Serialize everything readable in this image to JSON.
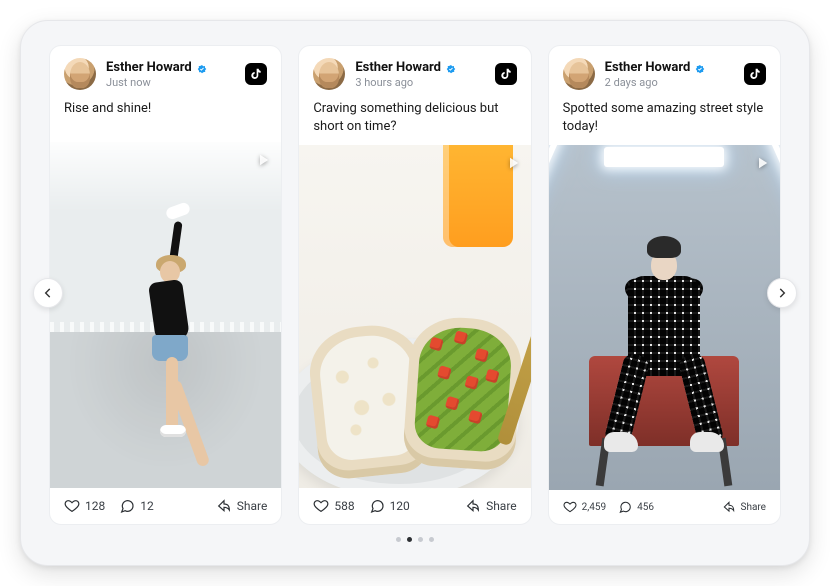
{
  "carousel": {
    "prev_label": "Previous",
    "next_label": "Next",
    "dots": {
      "count": 4,
      "active": 1
    }
  },
  "share_label": "Share",
  "posts": [
    {
      "username": "Esther Howard",
      "verified": true,
      "timestamp": "Just now",
      "platform": "tiktok",
      "caption": "Rise and shine!",
      "likes": "128",
      "comments": "12",
      "share": "Share",
      "footer_size": "normal"
    },
    {
      "username": "Esther Howard",
      "verified": true,
      "timestamp": "3 hours ago",
      "platform": "tiktok",
      "caption": "Craving something delicious but short on time?",
      "likes": "588",
      "comments": "120",
      "share": "Share",
      "footer_size": "normal"
    },
    {
      "username": "Esther Howard",
      "verified": true,
      "timestamp": "2 days ago",
      "platform": "tiktok",
      "caption": "Spotted some amazing street style today!",
      "likes": "2,459",
      "comments": "456",
      "share": "Share",
      "footer_size": "small"
    }
  ]
}
